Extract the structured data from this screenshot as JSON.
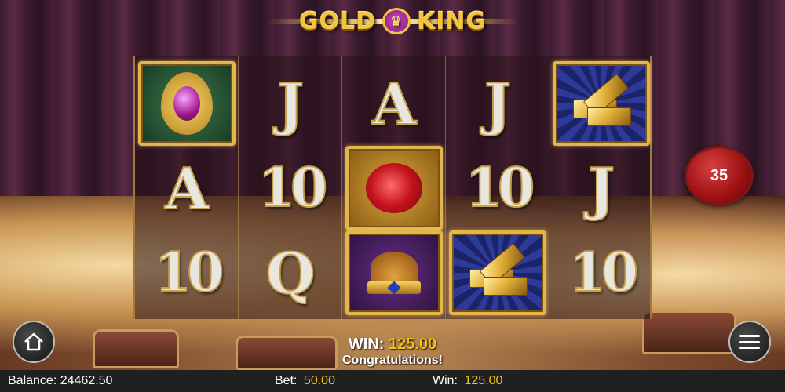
{
  "game": {
    "logo": "GOLD KING",
    "logo_left": "GOLD",
    "logo_right": "KING"
  },
  "reels": [
    [
      {
        "symbol": "amulet-icon",
        "label": ""
      },
      {
        "symbol": "letter",
        "label": "A"
      },
      {
        "symbol": "letter",
        "label": "10"
      }
    ],
    [
      {
        "symbol": "letter",
        "label": "J"
      },
      {
        "symbol": "letter",
        "label": "10"
      },
      {
        "symbol": "letter",
        "label": "Q"
      }
    ],
    [
      {
        "symbol": "letter",
        "label": "A"
      },
      {
        "symbol": "rose-icon",
        "label": ""
      },
      {
        "symbol": "crown-icon",
        "label": ""
      }
    ],
    [
      {
        "symbol": "letter",
        "label": "J"
      },
      {
        "symbol": "letter",
        "label": "10"
      },
      {
        "symbol": "gold-bars-icon",
        "label": ""
      }
    ],
    [
      {
        "symbol": "gold-bars-icon",
        "label": ""
      },
      {
        "symbol": "letter",
        "label": "J"
      },
      {
        "symbol": "letter",
        "label": "10"
      }
    ]
  ],
  "multiplier": "35",
  "win_message": {
    "label": "WIN:",
    "amount": "125.00",
    "congrats": "Congratulations!"
  },
  "status_bar": {
    "balance_label": "Balance:",
    "balance_value": "24462.50",
    "bet_label": "Bet:",
    "bet_value": "50.00",
    "win_label": "Win:",
    "win_value": "125.00"
  },
  "buttons": {
    "home_icon": "home-icon",
    "menu_icon": "hamburger-menu-icon"
  },
  "colors": {
    "accent_gold": "#f1c40f",
    "bubble_red": "#9a1010",
    "bar_bg": "#202020"
  }
}
